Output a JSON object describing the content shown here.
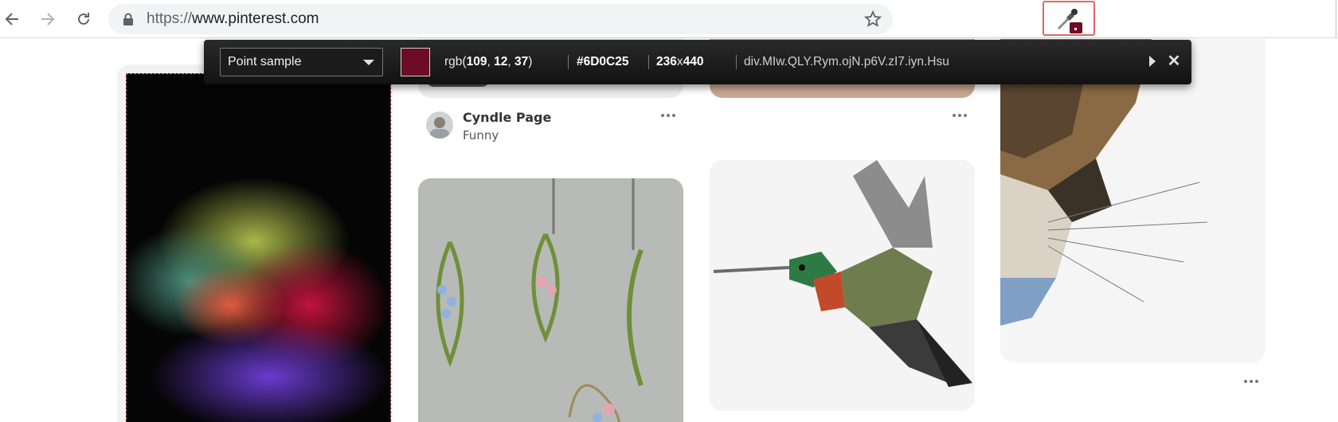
{
  "browser": {
    "url_scheme": "https://",
    "url_host": "www.pinterest.com",
    "back_icon": "arrow-left-icon",
    "forward_icon": "arrow-right-icon",
    "reload_icon": "reload-icon",
    "lock_icon": "lock-icon",
    "bookmark_icon": "star-icon",
    "extension_icon": "eyedropper-icon"
  },
  "picker": {
    "mode": "Point sample",
    "swatch_color": "#6D0C25",
    "rgb_prefix": "rgb(",
    "r": "109",
    "g": "12",
    "b": "37",
    "rgb_sep": ", ",
    "rgb_suffix": ")",
    "hex": "#6D0C25",
    "width": "236",
    "size_sep": "x",
    "height": "440",
    "selector": "div.MIw.QLY.Rym.ojN.p6V.zI7.iyn.Hsu"
  },
  "pins": [
    {
      "pinner_name": "Cyndle Page",
      "board": "Funny"
    }
  ],
  "colors": {
    "accent_highlight": "#e06666",
    "picked": "#6D0C25"
  }
}
